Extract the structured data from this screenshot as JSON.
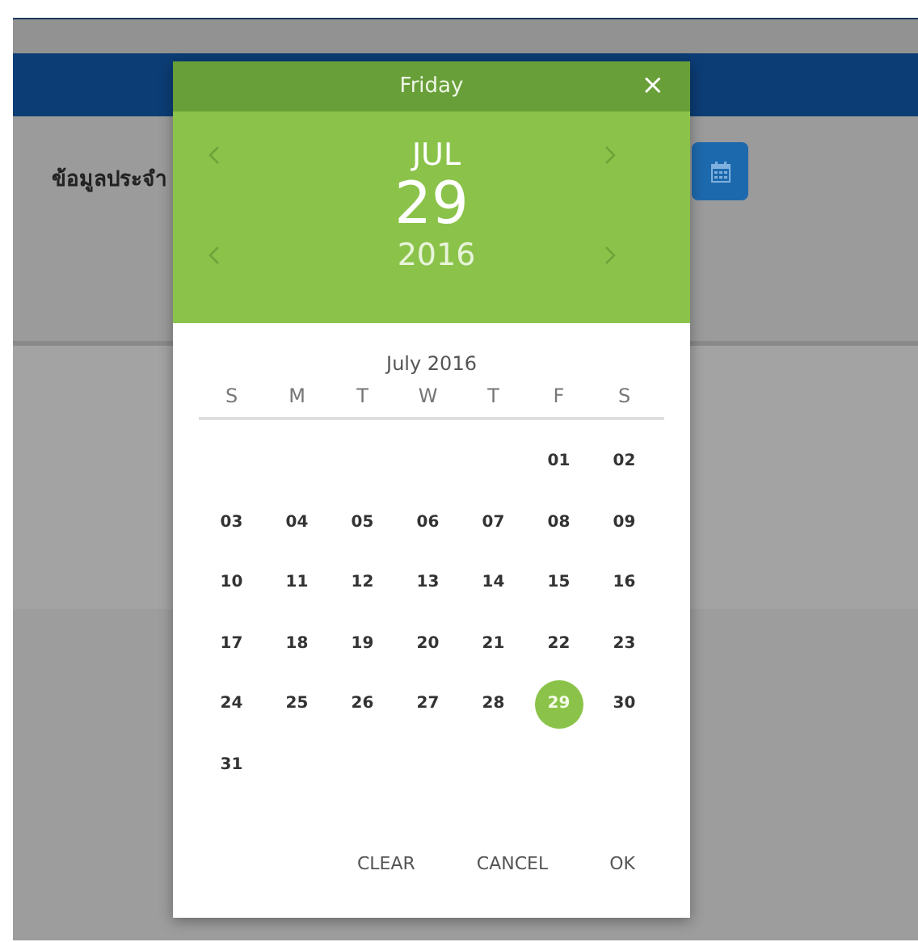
{
  "page": {
    "label": "ข้อมูลประจำ"
  },
  "date_picker": {
    "weekday": "Friday",
    "close": "×",
    "month": "JUL",
    "day": "29",
    "year": "2016",
    "calendar_title": "July 2016",
    "weekday_headers": [
      "S",
      "M",
      "T",
      "W",
      "T",
      "F",
      "S"
    ],
    "weeks": [
      {
        "days": [
          {
            "label": "01",
            "selected": false
          },
          {
            "label": "02",
            "selected": false
          }
        ]
      },
      {
        "days": [
          {
            "label": "03",
            "selected": false
          },
          {
            "label": "04",
            "selected": false
          },
          {
            "label": "05",
            "selected": false
          },
          {
            "label": "06",
            "selected": false
          },
          {
            "label": "07",
            "selected": false
          },
          {
            "label": "08",
            "selected": false
          },
          {
            "label": "09",
            "selected": false
          }
        ]
      },
      {
        "days": [
          {
            "label": "10",
            "selected": false
          },
          {
            "label": "11",
            "selected": false
          },
          {
            "label": "12",
            "selected": false
          },
          {
            "label": "13",
            "selected": false
          },
          {
            "label": "14",
            "selected": false
          },
          {
            "label": "15",
            "selected": false
          },
          {
            "label": "16",
            "selected": false
          }
        ]
      },
      {
        "days": [
          {
            "label": "17",
            "selected": false
          },
          {
            "label": "18",
            "selected": false
          },
          {
            "label": "19",
            "selected": false
          },
          {
            "label": "20",
            "selected": false
          },
          {
            "label": "21",
            "selected": false
          },
          {
            "label": "22",
            "selected": false
          },
          {
            "label": "23",
            "selected": false
          }
        ]
      },
      {
        "days": [
          {
            "label": "24",
            "selected": false
          },
          {
            "label": "25",
            "selected": false
          },
          {
            "label": "26",
            "selected": false
          },
          {
            "label": "27",
            "selected": false
          },
          {
            "label": "28",
            "selected": false
          },
          {
            "label": "29",
            "selected": true
          },
          {
            "label": "30",
            "selected": false
          }
        ]
      },
      {
        "days": [
          {
            "label": "31",
            "selected": false
          }
        ]
      }
    ],
    "buttons": [
      "CLEAR",
      "CANCEL",
      "OK"
    ]
  }
}
